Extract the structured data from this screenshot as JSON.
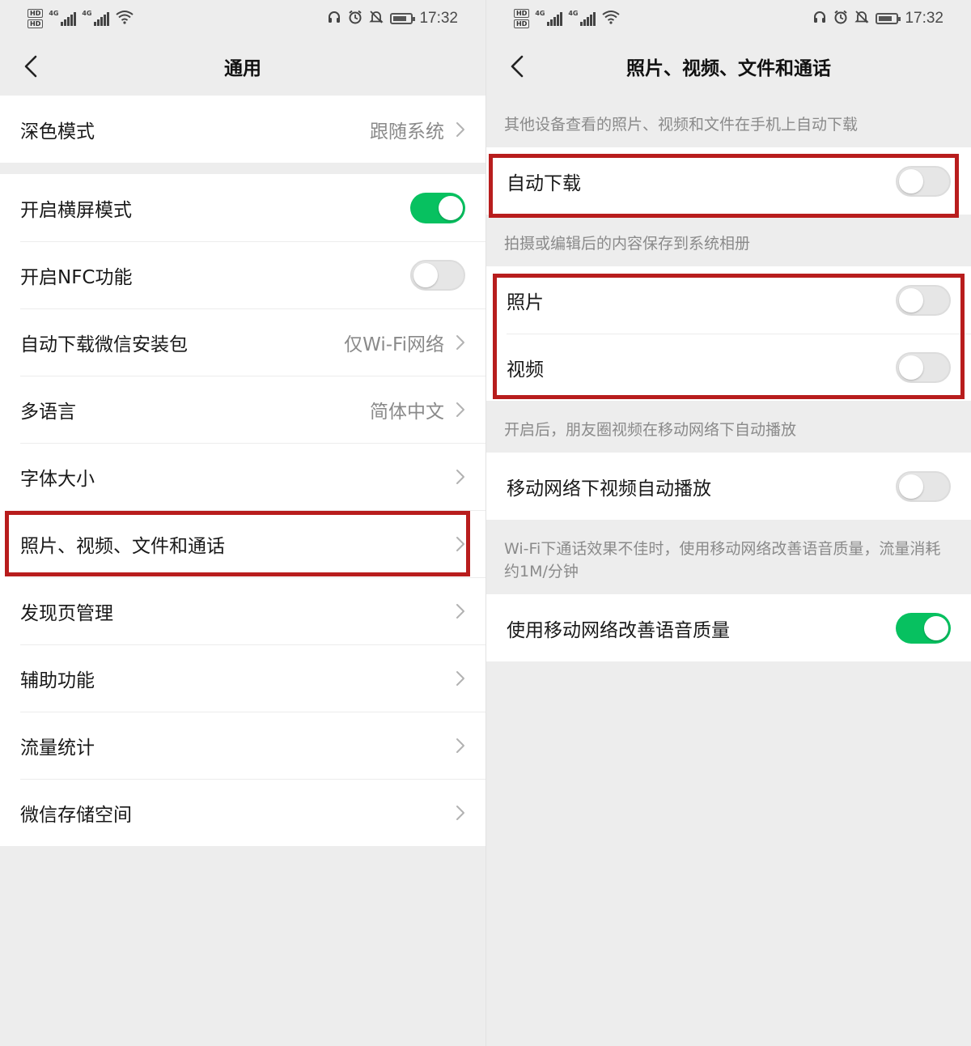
{
  "colors": {
    "accent_green": "#07c160",
    "highlight_red": "#b81d1d",
    "background": "#ededed"
  },
  "status_bar": {
    "left_labels": [
      "HD",
      "HD"
    ],
    "network": [
      "4G",
      "4G"
    ],
    "time": "17:32",
    "icons": [
      "hd-icon",
      "signal-icon",
      "wifi-icon",
      "headset-icon",
      "alarm-icon",
      "mute-icon",
      "battery-icon"
    ]
  },
  "left_screen": {
    "title": "通用",
    "sections": [
      {
        "rows": [
          {
            "label": "深色模式",
            "value": "跟随系统",
            "type": "link"
          }
        ]
      },
      {
        "rows": [
          {
            "label": "开启横屏模式",
            "type": "toggle",
            "on": true
          },
          {
            "label": "开启NFC功能",
            "type": "toggle",
            "on": false
          },
          {
            "label": "自动下载微信安装包",
            "value": "仅Wi-Fi网络",
            "type": "link"
          },
          {
            "label": "多语言",
            "value": "简体中文",
            "type": "link"
          },
          {
            "label": "字体大小",
            "type": "link"
          },
          {
            "label": "照片、视频、文件和通话",
            "type": "link",
            "highlighted": true
          },
          {
            "label": "发现页管理",
            "type": "link"
          },
          {
            "label": "辅助功能",
            "type": "link"
          },
          {
            "label": "流量统计",
            "type": "link"
          },
          {
            "label": "微信存储空间",
            "type": "link"
          }
        ]
      }
    ]
  },
  "right_screen": {
    "title": "照片、视频、文件和通话",
    "sections": [
      {
        "header": "其他设备查看的照片、视频和文件在手机上自动下载",
        "rows": [
          {
            "label": "自动下载",
            "type": "toggle",
            "on": false,
            "highlighted": true
          }
        ]
      },
      {
        "header": "拍摄或编辑后的内容保存到系统相册",
        "rows": [
          {
            "label": "照片",
            "type": "toggle",
            "on": false,
            "highlighted": true
          },
          {
            "label": "视频",
            "type": "toggle",
            "on": false,
            "highlighted": true
          }
        ]
      },
      {
        "header": "开启后，朋友圈视频在移动网络下自动播放",
        "rows": [
          {
            "label": "移动网络下视频自动播放",
            "type": "toggle",
            "on": false
          }
        ]
      },
      {
        "header": "Wi-Fi下通话效果不佳时，使用移动网络改善语音质量，流量消耗约1M/分钟",
        "rows": [
          {
            "label": "使用移动网络改善语音质量",
            "type": "toggle",
            "on": true
          }
        ]
      }
    ]
  }
}
